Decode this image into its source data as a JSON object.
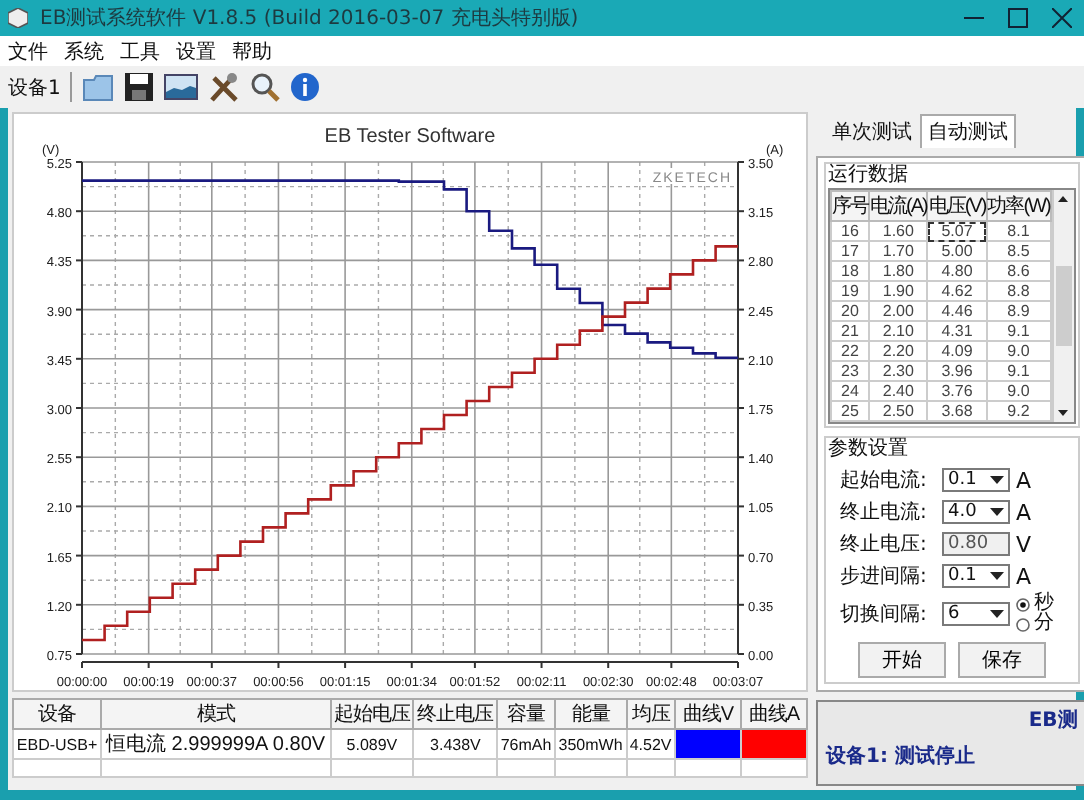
{
  "window": {
    "title": "EB测试系统软件 V1.8.5 (Build 2016-03-07 充电头特别版)"
  },
  "menu": [
    "文件",
    "系统",
    "工具",
    "设置",
    "帮助"
  ],
  "toolbar": {
    "device_label": "设备1"
  },
  "chart": {
    "brand_label": "ZKETECH",
    "chart_data": {
      "type": "line",
      "title": "EB Tester Software",
      "ylabel": "(V)",
      "y2label": "(A)",
      "grid": true,
      "x": [
        0,
        6.45,
        6.45,
        12.9,
        12.9,
        19.35,
        19.35,
        25.8,
        25.8,
        32.25,
        32.25,
        38.7,
        38.7,
        45.15,
        45.15,
        51.6,
        51.6,
        58.05,
        58.05,
        64.5,
        64.5,
        70.95,
        70.95,
        77.4,
        77.4,
        83.85,
        83.85,
        90.3,
        90.3,
        96.75,
        96.75,
        103.2,
        103.2,
        109.65,
        109.65,
        116.1,
        116.1,
        122.55,
        122.55,
        129,
        129,
        135.45,
        135.45,
        141.9,
        141.9,
        148.35,
        148.35,
        154.8,
        154.8,
        161.25,
        161.25,
        167.7,
        167.7,
        174.15,
        174.15,
        180.6,
        180.6,
        187
      ],
      "xlim": [
        0,
        187
      ],
      "ylim": [
        0.75,
        5.25
      ],
      "y2lim": [
        0,
        3.5
      ],
      "xticks": [
        {
          "value": 0,
          "label": "00:00:00"
        },
        {
          "value": 19,
          "label": "00:00:19"
        },
        {
          "value": 37,
          "label": "00:00:37"
        },
        {
          "value": 56,
          "label": "00:00:56"
        },
        {
          "value": 75,
          "label": "00:01:15"
        },
        {
          "value": 94,
          "label": "00:01:34"
        },
        {
          "value": 112,
          "label": "00:01:52"
        },
        {
          "value": 131,
          "label": "00:02:11"
        },
        {
          "value": 150,
          "label": "00:02:30"
        },
        {
          "value": 168,
          "label": "00:02:48"
        },
        {
          "value": 187,
          "label": "00:03:07"
        }
      ],
      "yticks": [
        {
          "value": 0.75,
          "label": "0.75"
        },
        {
          "value": 1.2,
          "label": "1.20"
        },
        {
          "value": 1.65,
          "label": "1.65"
        },
        {
          "value": 2.1,
          "label": "2.10"
        },
        {
          "value": 2.55,
          "label": "2.55"
        },
        {
          "value": 3.0,
          "label": "3.00"
        },
        {
          "value": 3.45,
          "label": "3.45"
        },
        {
          "value": 3.9,
          "label": "3.90"
        },
        {
          "value": 4.35,
          "label": "4.35"
        },
        {
          "value": 4.8,
          "label": "4.80"
        },
        {
          "value": 5.25,
          "label": "5.25"
        }
      ],
      "y2ticks": [
        {
          "value": 0,
          "label": "0.00"
        },
        {
          "value": 0.35,
          "label": "0.35"
        },
        {
          "value": 0.7,
          "label": "0.70"
        },
        {
          "value": 1.05,
          "label": "1.05"
        },
        {
          "value": 1.4,
          "label": "1.40"
        },
        {
          "value": 1.75,
          "label": "1.75"
        },
        {
          "value": 2.1,
          "label": "2.10"
        },
        {
          "value": 2.45,
          "label": "2.45"
        },
        {
          "value": 2.8,
          "label": "2.80"
        },
        {
          "value": 3.15,
          "label": "3.15"
        },
        {
          "value": 3.5,
          "label": "3.50"
        }
      ],
      "series": [
        {
          "color": "#1a1a80",
          "values": [
            5.08,
            5.08,
            5.08,
            5.08,
            5.08,
            5.08,
            5.08,
            5.08,
            5.08,
            5.08,
            5.08,
            5.08,
            5.08,
            5.08,
            5.08,
            5.08,
            5.08,
            5.08,
            5.08,
            5.08,
            5.08,
            5.08,
            5.08,
            5.08,
            5.08,
            5.08,
            5.08,
            5.08,
            5.07,
            5.07,
            5.07,
            5.07,
            5.0,
            5.0,
            4.8,
            4.8,
            4.62,
            4.62,
            4.46,
            4.46,
            4.31,
            4.31,
            4.09,
            4.09,
            3.96,
            3.96,
            3.76,
            3.76,
            3.68,
            3.68,
            3.6,
            3.6,
            3.55,
            3.55,
            3.5,
            3.5,
            3.46,
            3.46
          ]
        },
        {
          "color": "#b02020",
          "axis": "y2",
          "values": [
            0.1,
            0.1,
            0.2,
            0.2,
            0.3,
            0.3,
            0.4,
            0.4,
            0.5,
            0.5,
            0.6,
            0.6,
            0.7,
            0.7,
            0.8,
            0.8,
            0.9,
            0.9,
            1.0,
            1.0,
            1.1,
            1.1,
            1.2,
            1.2,
            1.3,
            1.3,
            1.4,
            1.4,
            1.5,
            1.5,
            1.6,
            1.6,
            1.7,
            1.7,
            1.8,
            1.8,
            1.9,
            1.9,
            2.0,
            2.0,
            2.1,
            2.1,
            2.2,
            2.2,
            2.3,
            2.3,
            2.4,
            2.4,
            2.5,
            2.5,
            2.6,
            2.6,
            2.7,
            2.7,
            2.8,
            2.8,
            2.9,
            2.9
          ]
        }
      ]
    }
  },
  "summary": {
    "columns": [
      "设备",
      "模式",
      "起始电压",
      "终止电压",
      "容量",
      "能量",
      "均压",
      "曲线V",
      "曲线A"
    ],
    "row": {
      "device": "EBD-USB+",
      "mode": "恒电流 2.999999A 0.80V",
      "start_voltage": "5.089V",
      "end_voltage": "3.438V",
      "capacity": "76mAh",
      "energy": "350mWh",
      "avg_voltage": "4.52V",
      "curves": [
        {
          "color": "#0000ff"
        },
        {
          "color": "#ff0000"
        }
      ]
    }
  },
  "tabs": [
    {
      "label": "单次测试",
      "selected": false
    },
    {
      "label": "自动测试",
      "selected": true
    }
  ],
  "run_data": {
    "title": "运行数据",
    "columns": [
      "序号",
      "电流(A)",
      "电压(V)",
      "功率(W)"
    ],
    "rows": [
      {
        "cells": [
          "16",
          "1.60",
          "5.07",
          "8.1"
        ],
        "focused": true
      },
      {
        "cells": [
          "17",
          "1.70",
          "5.00",
          "8.5"
        ],
        "focused": false
      },
      {
        "cells": [
          "18",
          "1.80",
          "4.80",
          "8.6"
        ],
        "focused": false
      },
      {
        "cells": [
          "19",
          "1.90",
          "4.62",
          "8.8"
        ],
        "focused": false
      },
      {
        "cells": [
          "20",
          "2.00",
          "4.46",
          "8.9"
        ],
        "focused": false
      },
      {
        "cells": [
          "21",
          "2.10",
          "4.31",
          "9.1"
        ],
        "focused": false
      },
      {
        "cells": [
          "22",
          "2.20",
          "4.09",
          "9.0"
        ],
        "focused": false
      },
      {
        "cells": [
          "23",
          "2.30",
          "3.96",
          "9.1"
        ],
        "focused": false
      },
      {
        "cells": [
          "24",
          "2.40",
          "3.76",
          "9.0"
        ],
        "focused": false
      },
      {
        "cells": [
          "25",
          "2.50",
          "3.68",
          "9.2"
        ],
        "focused": false
      }
    ]
  },
  "params": {
    "title": "参数设置",
    "fields": [
      {
        "label": "起始电流:",
        "kind": "dropdown",
        "value": "0.1",
        "unit": "A",
        "disabled": false
      },
      {
        "label": "终止电流:",
        "kind": "dropdown",
        "value": "4.0",
        "unit": "A",
        "disabled": false
      },
      {
        "label": "终止电压:",
        "kind": "text",
        "value": "0.80",
        "unit": "V",
        "disabled": true
      },
      {
        "label": "步进间隔:",
        "kind": "dropdown",
        "value": "0.1",
        "unit": "A",
        "disabled": false
      },
      {
        "label": "切换间隔:",
        "kind": "dropdown",
        "value": "6",
        "disabled": false,
        "radios": [
          {
            "label": "秒",
            "selected": true
          },
          {
            "label": "分",
            "selected": false
          }
        ]
      }
    ],
    "buttons": [
      "开始",
      "保存"
    ]
  },
  "status": {
    "title": "EB测",
    "message": "设备1: 测试停止"
  }
}
